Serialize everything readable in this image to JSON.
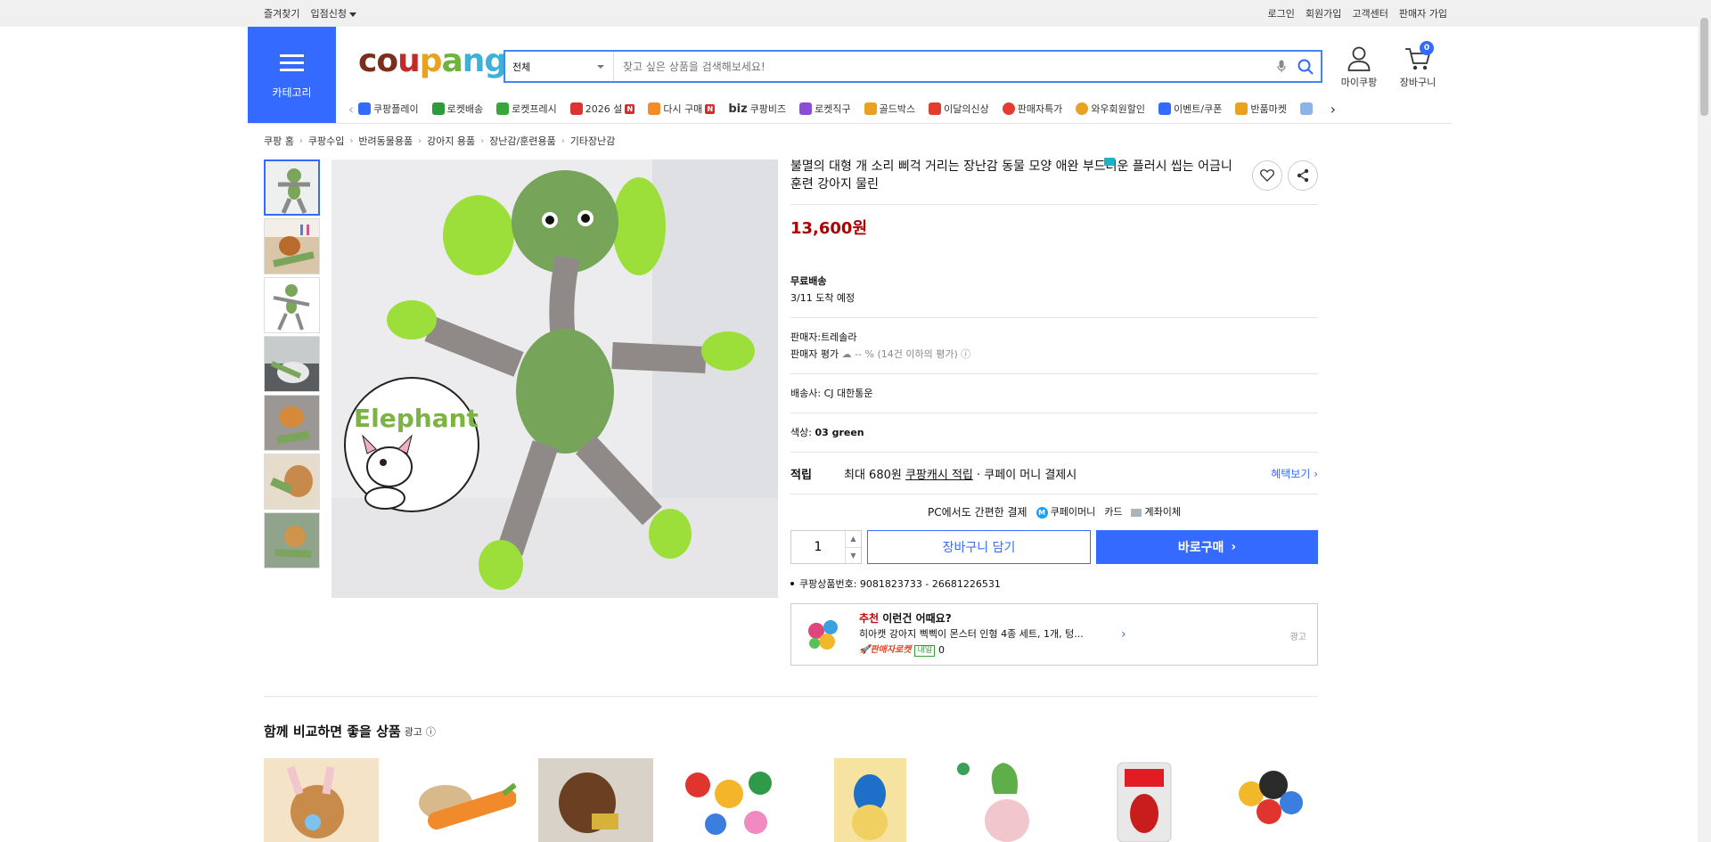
{
  "topbar": {
    "left": [
      "즐겨찾기",
      "입점신청"
    ],
    "right": [
      "로그인",
      "회원가입",
      "고객센터",
      "판매자 가입"
    ]
  },
  "category": {
    "label": "카테고리"
  },
  "logo": {
    "c1": "co",
    "c2": "u",
    "c3": "p",
    "c4": "a",
    "c5": "ng"
  },
  "search": {
    "scope": "전체",
    "placeholder": "찾고 싶은 상품을 검색해보세요!"
  },
  "header": {
    "mypage": "마이쿠팡",
    "cart": "장바구니",
    "cart_count": "0"
  },
  "nav": [
    {
      "label": "쿠팡플레이",
      "color": "#346aff"
    },
    {
      "label": "로켓배송",
      "color": "#2d9b3a"
    },
    {
      "label": "로켓프레시",
      "color": "#3aa53a"
    },
    {
      "label": "2026 설",
      "color": "#d33",
      "badge": "N"
    },
    {
      "label": "다시 구매",
      "color": "#f28c28",
      "badge": "N"
    },
    {
      "label": "쿠팡비즈",
      "color": "#1a1a1a",
      "prefix": "biz"
    },
    {
      "label": "로켓직구",
      "color": "#8b4dd8"
    },
    {
      "label": "골드박스",
      "color": "#e8a121"
    },
    {
      "label": "이달의신상",
      "color": "#e33d2f"
    },
    {
      "label": "판매자특가",
      "color": "#e33d2f"
    },
    {
      "label": "와우회원할인",
      "color": "#e8a121"
    },
    {
      "label": "이벤트/쿠폰",
      "color": "#346aff"
    },
    {
      "label": "반품마켓",
      "color": "#e8a121"
    }
  ],
  "breadcrumb": [
    "쿠팡 홈",
    "쿠팡수입",
    "반려동물용품",
    "강아지 용품",
    "장난감/훈련용품",
    "기타장난감"
  ],
  "product": {
    "title": "불멸의 대형 개 소리 삐걱 거리는 장난감 동물 모양 애완 부드러운 플러시 씹는 어금니 훈련 강아지 물린",
    "image_text": "Elephant",
    "price": "13,600원",
    "shipping_label": "무료배송",
    "arrival": "3/11 도착 예정",
    "seller": "판매자:트레솔라",
    "seller_rating_label": "판매자 평가",
    "seller_rating": "-- % (14건 이하의 평가)",
    "courier_label": "배송사:",
    "courier": "CJ 대한통운",
    "color_label": "색상:",
    "color": "03 green",
    "earn_label": "적립",
    "earn_pre": "최대 680원",
    "earn_link": "쿠팡캐시 적립",
    "earn_post": "· 쿠페이 머니 결제시",
    "benefits": "혜택보기",
    "pay_heading": "PC에서도 간편한 결제",
    "pay_methods": [
      "쿠페이머니",
      "카드",
      "계좌이체"
    ],
    "quantity": "1",
    "add_cart": "장바구니 담기",
    "buy_now": "바로구매",
    "product_id": "쿠팡상품번호: 9081823733 - 26681226531"
  },
  "reco": {
    "tag": "추천",
    "tag_rest": " 이런건 어때요?",
    "name": "히아캣 강아지 삑삑이 몬스터 인형 4종 세트, 1개, 텅...",
    "seller_rocket": "판매자로켓",
    "tomorrow": "내일",
    "count": "0",
    "ad": "광고"
  },
  "compare": {
    "title": "함께 비교하면 좋을 상품",
    "ad": "광고"
  }
}
